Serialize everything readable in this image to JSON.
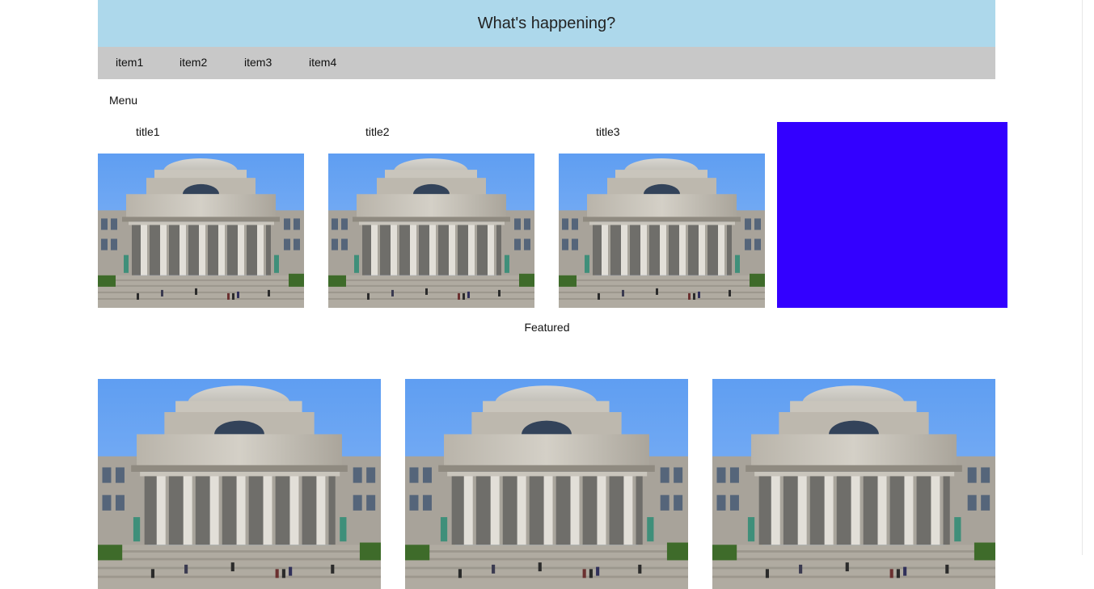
{
  "header": {
    "title": "What's happening?"
  },
  "nav": {
    "items": [
      "item1",
      "item2",
      "item3",
      "item4"
    ]
  },
  "menu": {
    "label": "Menu"
  },
  "cards": [
    {
      "title": "title1",
      "image": "library-building-photo"
    },
    {
      "title": "title2",
      "image": "library-building-photo"
    },
    {
      "title": "title3",
      "image": "library-building-photo"
    }
  ],
  "promo_block": {
    "color": "#3300ff"
  },
  "featured": {
    "label": "Featured",
    "images": [
      "library-building-photo",
      "library-building-photo",
      "library-building-photo"
    ]
  },
  "colors": {
    "header_bg": "#add8eb",
    "nav_bg": "#c8c8c8",
    "sky": "#6aa2f0",
    "block": "#3300ff"
  }
}
